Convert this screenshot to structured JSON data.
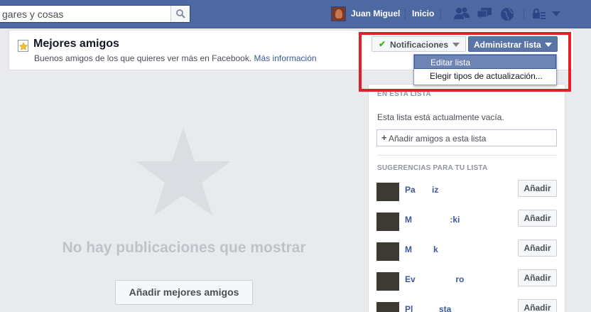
{
  "topbar": {
    "search_text": "gares y cosas",
    "user_name": "Juan Miguel",
    "home_label": "Inicio",
    "icons": [
      "friend-requests-icon",
      "messages-icon",
      "notifications-globe-icon",
      "privacy-lock-icon",
      "settings-caret-icon"
    ]
  },
  "list": {
    "title": "Mejores amigos",
    "description": "Buenos amigos de los que quieres ver más en Facebook.",
    "more_info_link": "Más información",
    "notifications_button": "Notificaciones",
    "manage_button": "Administrar lista"
  },
  "dropdown": {
    "items": [
      "Editar lista",
      "Elegir tipos de actualización..."
    ],
    "active_index": 0
  },
  "sidebar": {
    "in_list_heading": "EN ESTA LISTA",
    "empty_text": "Esta lista está actualmente vacía.",
    "add_placeholder": "Añadir amigos a esta lista",
    "suggestions_heading": "SUGERENCIAS PARA TU LISTA",
    "suggestions": [
      {
        "name": "Pa       iz",
        "button": "Añadir"
      },
      {
        "name": "M                :ki",
        "button": "Añadir"
      },
      {
        "name": "M         k",
        "button": "Añadir"
      },
      {
        "name": "Ev                 ro",
        "button": "Añadir"
      },
      {
        "name": "Pl           sta",
        "button": "Añadir"
      }
    ]
  },
  "main": {
    "empty_message": "No hay publicaciones que mostrar",
    "add_best_friends_button": "Añadir mejores amigos"
  },
  "colors": {
    "topbar": "#4e69a2",
    "highlight": "#e41f26",
    "link": "#3b5998",
    "dropdown_active": "#6d84b4"
  }
}
